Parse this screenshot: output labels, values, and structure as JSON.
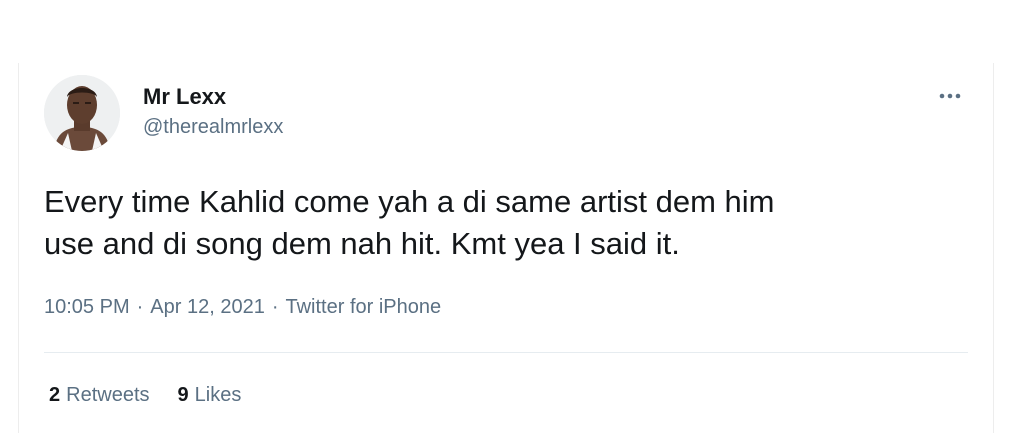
{
  "tweet": {
    "author": {
      "display_name": "Mr Lexx",
      "handle": "@therealmrlexx",
      "avatar_icon": "profile-photo"
    },
    "more_icon": "more-horizontal-icon",
    "text": "Every time Kahlid come yah a di same artist dem him\nuse and di song dem nah hit. Kmt yea I said it.",
    "time": "10:05 PM",
    "separator": "·",
    "date": "Apr 12, 2021",
    "source": "Twitter for iPhone",
    "stats": {
      "retweets_count": "2",
      "retweets_label": "Retweets",
      "likes_count": "9",
      "likes_label": "Likes"
    }
  },
  "colors": {
    "text_primary": "#14171a",
    "text_secondary": "#5b7083",
    "divider": "#e6ecf0"
  }
}
